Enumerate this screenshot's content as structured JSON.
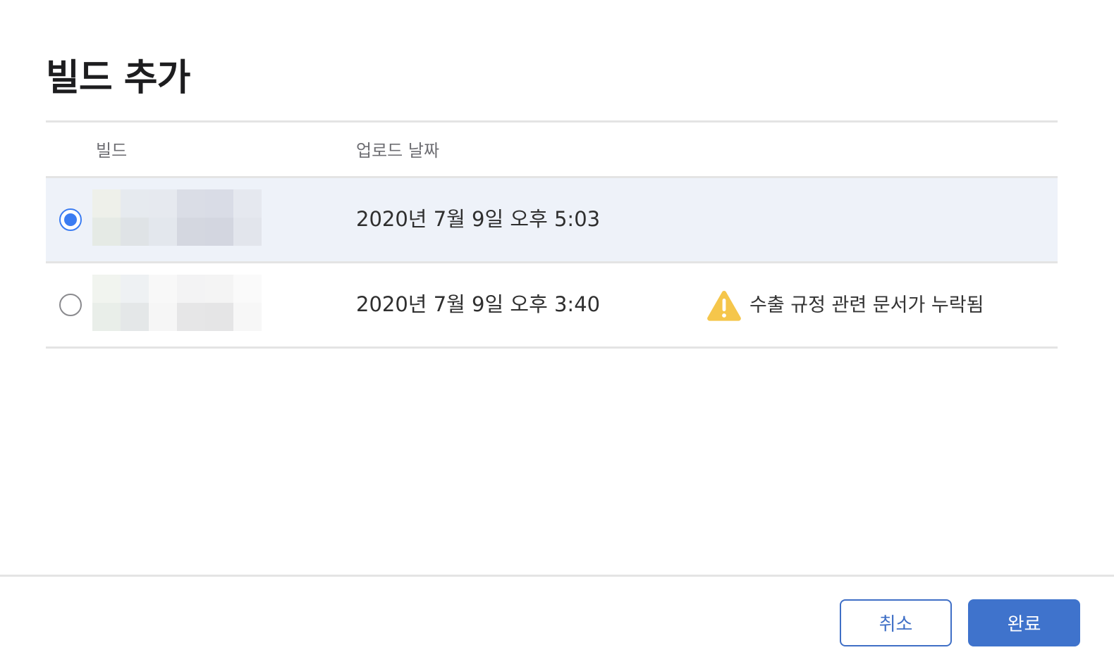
{
  "dialog": {
    "title": "빌드 추가"
  },
  "table": {
    "columns": {
      "build": "빌드",
      "upload_date": "업로드 날짜"
    },
    "rows": [
      {
        "selected": true,
        "upload_date": "2020년 7월 9일 오후 5:03",
        "warning": ""
      },
      {
        "selected": false,
        "upload_date": "2020년 7월 9일 오후 3:40",
        "warning": "수출 규정 관련 문서가 누락됨"
      }
    ]
  },
  "buttons": {
    "cancel": "취소",
    "done": "완료"
  },
  "colors": {
    "accent": "#3f73cc",
    "radio_selected": "#3b7cf2",
    "selected_row": "#eef2f9",
    "warning": "#f5c64b"
  },
  "icons": {
    "warning": "warning-triangle-icon"
  }
}
